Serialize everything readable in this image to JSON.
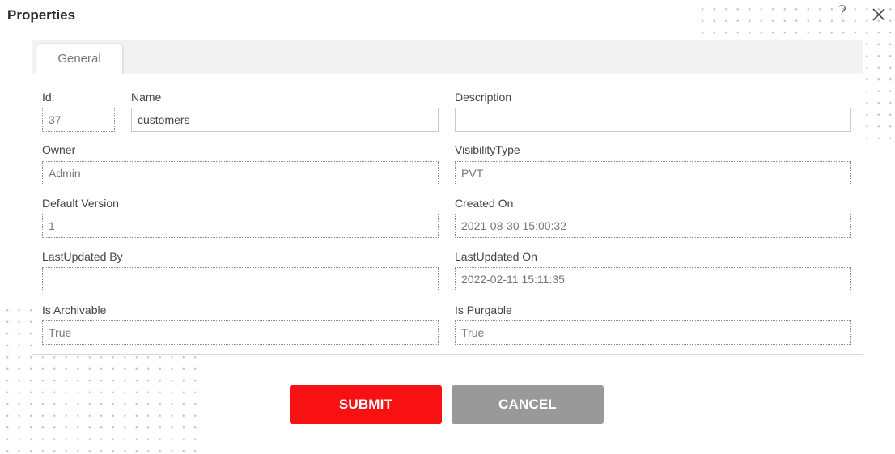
{
  "dialog": {
    "title": "Properties",
    "help_glyph": "?",
    "help_icon": "help-icon",
    "close_icon": "close-icon"
  },
  "tabs": [
    {
      "label": "General",
      "active": true
    }
  ],
  "fields": {
    "id": {
      "label": "Id:",
      "value": "37",
      "readonly": true
    },
    "name": {
      "label": "Name",
      "value": "customers",
      "readonly": false
    },
    "description": {
      "label": "Description",
      "value": "",
      "readonly": false
    },
    "owner": {
      "label": "Owner",
      "value": "Admin",
      "readonly": true
    },
    "visibility_type": {
      "label": "VisibilityType",
      "value": "PVT",
      "readonly": true
    },
    "default_version": {
      "label": "Default Version",
      "value": "1",
      "readonly": true
    },
    "created_on": {
      "label": "Created On",
      "value": "2021-08-30 15:00:32",
      "readonly": true
    },
    "last_updated_by": {
      "label": "LastUpdated By",
      "value": "",
      "readonly": true
    },
    "last_updated_on": {
      "label": "LastUpdated On",
      "value": "2022-02-11 15:11:35",
      "readonly": true
    },
    "is_archivable": {
      "label": "Is Archivable",
      "value": "True",
      "readonly": true
    },
    "is_purgable": {
      "label": "Is Purgable",
      "value": "True",
      "readonly": true
    }
  },
  "buttons": {
    "submit_label": "SUBMIT",
    "cancel_label": "CANCEL"
  },
  "colors": {
    "submit": "#f71113",
    "cancel": "#999999",
    "dots": "#b9c3e6"
  }
}
